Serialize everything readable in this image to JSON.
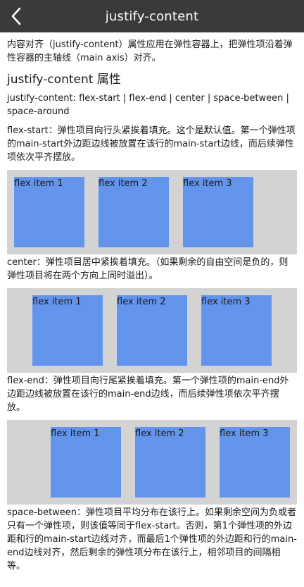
{
  "header": {
    "title": "justify-content",
    "back_icon": "chevron-left-icon"
  },
  "intro": "内容对齐（justify-content）属性应用在弹性容器上，把弹性项沿着弹性容器的主轴线（main axis）对齐。",
  "section_title": "justify-content 属性",
  "syntax": "justify-content: flex-start | flex-end | center | space-between | space-around",
  "colors": {
    "item": "#6495ed",
    "container": "#d3d3d3",
    "header": "#3a3a3a"
  },
  "sections": [
    {
      "desc": "flex-start：弹性项目向行头紧挨着填充。这个是默认值。第一个弹性项的main-start外边距边线被放置在该行的main-start边线，而后续弹性项依次平齐摆放。",
      "items": [
        "flex item 1",
        "flex item 2",
        "flex item 3"
      ]
    },
    {
      "desc": "center：弹性项目居中紧挨着填充。（如果剩余的自由空间是负的，则弹性项目将在两个方向上同时溢出）。",
      "items": [
        "flex item 1",
        "flex item 2",
        "flex item 3"
      ]
    },
    {
      "desc": "flex-end：弹性项目向行尾紧挨着填充。第一个弹性项的main-end外边距边线被放置在该行的main-end边线，而后续弹性项依次平齐摆放。",
      "items": [
        "flex item 1",
        "flex item 2",
        "flex item 3"
      ]
    },
    {
      "desc": "space-between：弹性项目平均分布在该行上。如果剩余空间为负或者只有一个弹性项，则该值等同于flex-start。否则，第1个弹性项的外边距和行的main-start边线对齐，而最后1个弹性项的外边距和行的main-end边线对齐，然后剩余的弹性项分布在该行上，相邻项目的间隔相等。"
    }
  ]
}
